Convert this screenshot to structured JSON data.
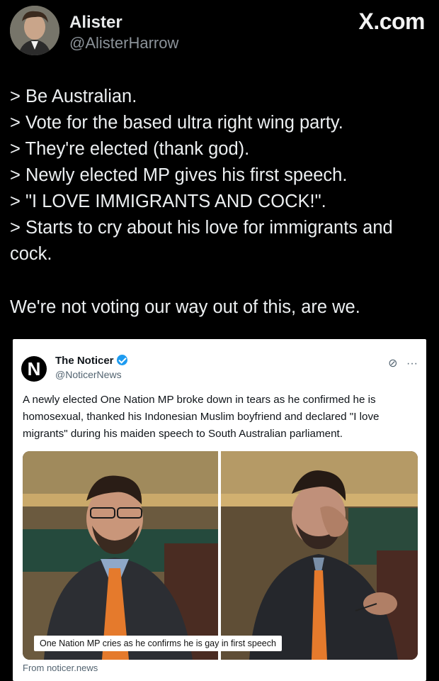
{
  "author": {
    "name": "Alister",
    "handle": "@AlisterHarrow"
  },
  "brand": "X.com",
  "tweet": {
    "lines": [
      "> Be Australian.",
      "> Vote for the based ultra right wing party.",
      "> They're elected (thank god).",
      "> Newly elected MP gives his first speech.",
      "> \"I LOVE IMMIGRANTS AND COCK!\".",
      "> Starts to cry about his love for immigrants and cock."
    ],
    "closing": "We're not voting our way out of this, are we."
  },
  "embed": {
    "logo_letter": "N",
    "name": "The Noticer",
    "handle": "@NoticerNews",
    "text": "A newly elected One Nation MP broke down in tears as he confirmed he is homosexual, thanked his Indonesian Muslim boyfriend and declared \"I love migrants\" during his maiden speech to South Australian parliament.",
    "caption": "One Nation MP cries as he confirms he is gay in first speech",
    "source": "From noticer.news",
    "icons": [
      "grok-icon",
      "more-icon"
    ]
  },
  "colors": {
    "background": "#000000",
    "verified": "#1d9bf0",
    "tie": "#e57a2c"
  }
}
